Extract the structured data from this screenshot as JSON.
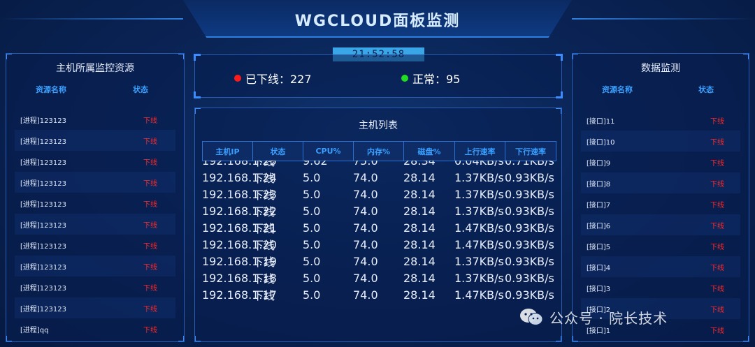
{
  "header": {
    "title": "WGCLOUD面板监测"
  },
  "clock": {
    "time": "21:52:58"
  },
  "summary": {
    "offline_label": "已下线：227",
    "normal_label": "正常：95",
    "offline_color": "#ff1a1a",
    "normal_color": "#22dd22"
  },
  "left_panel": {
    "title": "主机所属监控资源",
    "col_name": "资源名称",
    "col_status": "状态",
    "rows": [
      {
        "name": "[进程]123123",
        "status": "下线"
      },
      {
        "name": "[进程]123123",
        "status": "下线"
      },
      {
        "name": "[进程]123123",
        "status": "下线"
      },
      {
        "name": "[进程]123123",
        "status": "下线"
      },
      {
        "name": "[进程]123123",
        "status": "下线"
      },
      {
        "name": "[进程]123123",
        "status": "下线"
      },
      {
        "name": "[进程]123123",
        "status": "下线"
      },
      {
        "name": "[进程]123123",
        "status": "下线"
      },
      {
        "name": "[进程]123123",
        "status": "下线"
      },
      {
        "name": "[进程]123123",
        "status": "下线"
      },
      {
        "name": "[进程]qq",
        "status": "下线"
      }
    ]
  },
  "table_panel": {
    "title": "主机列表",
    "columns": [
      "主机IP",
      "状态",
      "CPU%",
      "内存%",
      "磁盘%",
      "上行速率",
      "下行速率"
    ],
    "rows": [
      [
        "192.168.1.25",
        "下线",
        "9.62",
        "75.0",
        "28.34",
        "0.04KB/s",
        "0.71KB/s"
      ],
      [
        "192.168.1.24",
        "下线",
        "5.0",
        "74.0",
        "28.14",
        "1.37KB/s",
        "0.93KB/s"
      ],
      [
        "192.168.1.23",
        "下线",
        "5.0",
        "74.0",
        "28.14",
        "1.37KB/s",
        "0.93KB/s"
      ],
      [
        "192.168.1.22",
        "下线",
        "5.0",
        "74.0",
        "28.14",
        "1.37KB/s",
        "0.93KB/s"
      ],
      [
        "192.168.1.21",
        "下线",
        "5.0",
        "74.0",
        "28.14",
        "1.47KB/s",
        "0.93KB/s"
      ],
      [
        "192.168.1.20",
        "下线",
        "5.0",
        "74.0",
        "28.14",
        "1.47KB/s",
        "0.93KB/s"
      ],
      [
        "192.168.1.19",
        "下线",
        "5.0",
        "74.0",
        "28.14",
        "1.37KB/s",
        "0.93KB/s"
      ],
      [
        "192.168.1.18",
        "下线",
        "5.0",
        "74.0",
        "28.14",
        "1.37KB/s",
        "0.93KB/s"
      ],
      [
        "192.168.1.17",
        "下线",
        "5.0",
        "74.0",
        "28.14",
        "1.47KB/s",
        "0.93KB/s"
      ]
    ]
  },
  "right_panel": {
    "title": "数据监测",
    "col_name": "资源名称",
    "col_status": "状态",
    "rows": [
      {
        "name": "[接口]11",
        "status": "下线"
      },
      {
        "name": "[接口]10",
        "status": "下线"
      },
      {
        "name": "[接口]9",
        "status": "下线"
      },
      {
        "name": "[接口]8",
        "status": "下线"
      },
      {
        "name": "[接口]7",
        "status": "下线"
      },
      {
        "name": "[接口]6",
        "status": "下线"
      },
      {
        "name": "[接口]5",
        "status": "下线"
      },
      {
        "name": "[接口]4",
        "status": "下线"
      },
      {
        "name": "[接口]3",
        "status": "下线"
      },
      {
        "name": "[接口]2",
        "status": "下线"
      },
      {
        "name": "[接口]1",
        "status": "下线"
      }
    ]
  },
  "watermark": {
    "text": "公众号 · 院长技术",
    "icon": "wechat-icon"
  }
}
